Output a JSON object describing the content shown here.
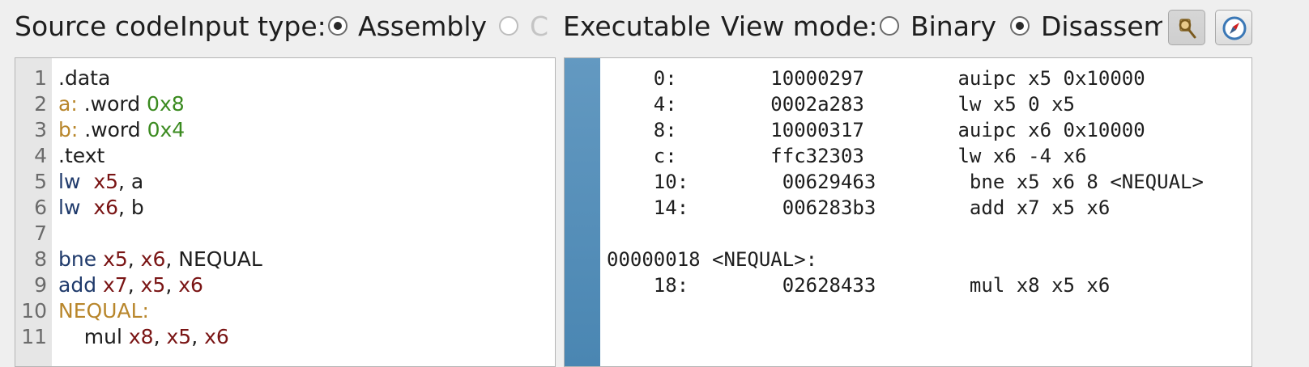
{
  "toolbar": {
    "source_code_label": "Source code",
    "input_type_label": "Input type:",
    "input_options": [
      {
        "label": "Assembly",
        "checked": true,
        "enabled": true
      },
      {
        "label": "C",
        "checked": false,
        "enabled": false
      },
      {
        "label": "Executable (",
        "checked": false,
        "enabled": true
      }
    ],
    "view_mode_label": "View mode:",
    "view_options": [
      {
        "label": "Binary",
        "checked": false
      },
      {
        "label": "Disassembly",
        "checked": true
      }
    ],
    "buttons": [
      {
        "icon": "inspect-icon",
        "pressed": true
      },
      {
        "icon": "compass-icon",
        "pressed": false
      }
    ]
  },
  "editor": {
    "line_numbers": [
      "1",
      "2",
      "3",
      "4",
      "5",
      "6",
      "7",
      "8",
      "9",
      "10",
      "11"
    ],
    "lines": [
      [
        {
          "t": ".data",
          "c": "plain"
        }
      ],
      [
        {
          "t": "a:",
          "c": "lbl"
        },
        {
          "t": " .word ",
          "c": "plain"
        },
        {
          "t": "0x8",
          "c": "num"
        }
      ],
      [
        {
          "t": "b:",
          "c": "lbl"
        },
        {
          "t": " .word ",
          "c": "plain"
        },
        {
          "t": "0x4",
          "c": "num"
        }
      ],
      [
        {
          "t": ".text",
          "c": "plain"
        }
      ],
      [
        {
          "t": "lw",
          "c": "kw"
        },
        {
          "t": "  ",
          "c": "plain"
        },
        {
          "t": "x5",
          "c": "reg"
        },
        {
          "t": ", a",
          "c": "plain"
        }
      ],
      [
        {
          "t": "lw",
          "c": "kw"
        },
        {
          "t": "  ",
          "c": "plain"
        },
        {
          "t": "x6",
          "c": "reg"
        },
        {
          "t": ", b",
          "c": "plain"
        }
      ],
      [],
      [
        {
          "t": "bne",
          "c": "kw"
        },
        {
          "t": " ",
          "c": "plain"
        },
        {
          "t": "x5",
          "c": "reg"
        },
        {
          "t": ", ",
          "c": "plain"
        },
        {
          "t": "x6",
          "c": "reg"
        },
        {
          "t": ", NEQUAL",
          "c": "plain"
        }
      ],
      [
        {
          "t": "add",
          "c": "kw"
        },
        {
          "t": " ",
          "c": "plain"
        },
        {
          "t": "x7",
          "c": "reg"
        },
        {
          "t": ", ",
          "c": "plain"
        },
        {
          "t": "x5",
          "c": "reg"
        },
        {
          "t": ", ",
          "c": "plain"
        },
        {
          "t": "x6",
          "c": "reg"
        }
      ],
      [
        {
          "t": "NEQUAL:",
          "c": "lbl"
        }
      ],
      [
        {
          "t": "    mul ",
          "c": "plain"
        },
        {
          "t": "x8",
          "c": "reg"
        },
        {
          "t": ", ",
          "c": "plain"
        },
        {
          "t": "x5",
          "c": "reg"
        },
        {
          "t": ", ",
          "c": "plain"
        },
        {
          "t": "x6",
          "c": "reg"
        }
      ]
    ]
  },
  "disassembly": {
    "lines": [
      "    0:        10000297        auipc x5 0x10000",
      "    4:        0002a283        lw x5 0 x5",
      "    8:        10000317        auipc x6 0x10000",
      "    c:        ffc32303        lw x6 -4 x6",
      "    10:        00629463        bne x5 x6 8 <NEQUAL>",
      "    14:        006283b3        add x7 x5 x6",
      "",
      "00000018 <NEQUAL>:",
      "    18:        02628433        mul x8 x5 x6"
    ]
  }
}
